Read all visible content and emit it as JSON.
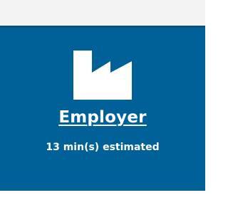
{
  "card": {
    "icon": "factory-icon",
    "title": "Employer",
    "subtitle": "13 min(s) estimated",
    "colors": {
      "accent": "#006199",
      "accent_dark": "#0b4f7e",
      "text": "#ffffff"
    }
  }
}
